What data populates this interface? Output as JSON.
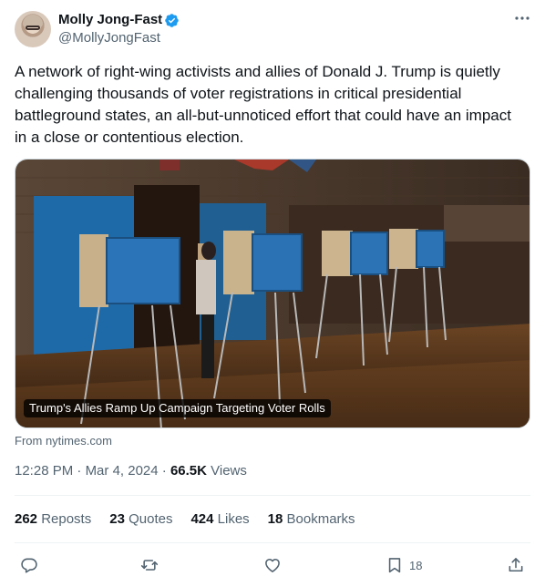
{
  "author": {
    "name": "Molly Jong-Fast",
    "handle": "@MollyJongFast",
    "verified_color": "#1d9bf0"
  },
  "tweet": {
    "text": "A network of right-wing activists and allies of Donald J. Trump is quietly challenging thousands of voter registrations in critical presidential battleground states, an all-but-unnoticed effort that could have an impact in a close or contentious election."
  },
  "card": {
    "caption": "Trump's Allies Ramp Up Campaign Targeting Voter Rolls",
    "source": "From nytimes.com"
  },
  "meta": {
    "time": "12:28 PM",
    "sep1": " · ",
    "date": "Mar 4, 2024",
    "sep2": " · ",
    "views_count": "66.5K",
    "views_label": " Views"
  },
  "stats": {
    "reposts_count": "262",
    "reposts_label": " Reposts",
    "quotes_count": "23",
    "quotes_label": " Quotes",
    "likes_count": "424",
    "likes_label": " Likes",
    "bookmarks_count": "18",
    "bookmarks_label": " Bookmarks"
  },
  "actions": {
    "bookmark_count": "18",
    "icons": [
      "reply-icon",
      "repost-icon",
      "like-icon",
      "bookmark-icon",
      "share-icon"
    ]
  },
  "colors": {
    "text_primary": "#0f1419",
    "text_secondary": "#536471",
    "divider": "#eff3f4"
  }
}
